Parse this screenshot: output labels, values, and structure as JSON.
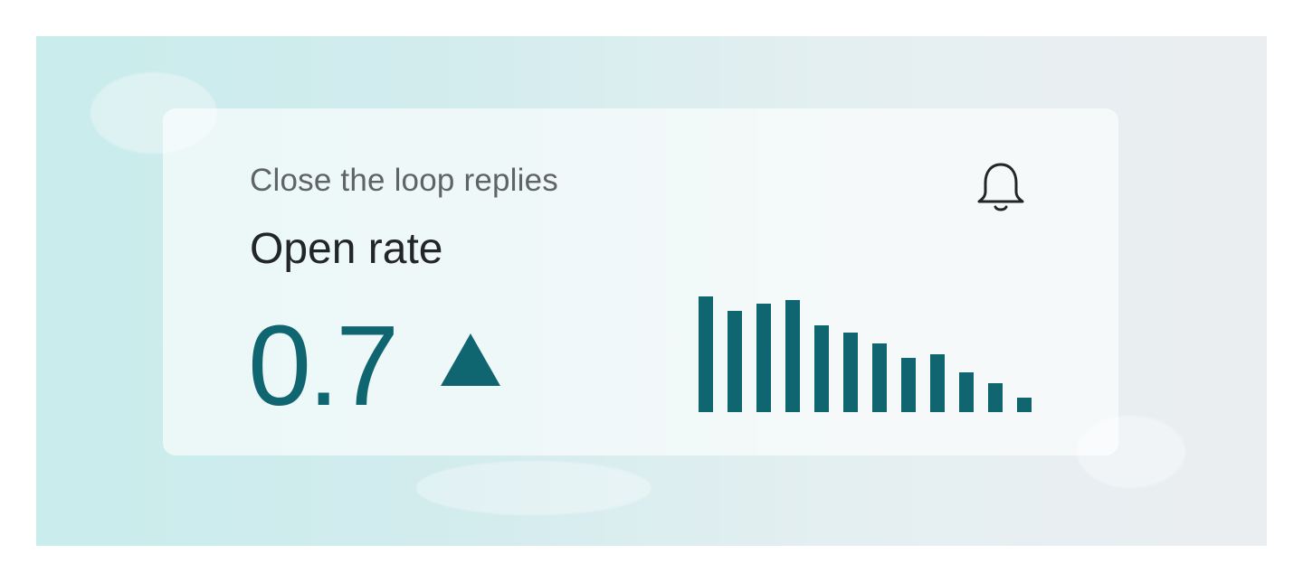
{
  "card": {
    "subtitle": "Close the loop replies",
    "title": "Open rate",
    "metric_value": "0.7",
    "trend_direction": "up",
    "trend_icon": "triangle-up-icon",
    "notification_icon": "bell-icon"
  },
  "colors": {
    "accent": "#0f6670",
    "title_text": "#232628",
    "subtitle_text": "#5f6467",
    "card_background": "#f1f5f6"
  },
  "chart_data": {
    "type": "bar",
    "values": [
      128,
      112,
      120,
      124,
      96,
      88,
      76,
      60,
      64,
      44,
      32,
      16
    ]
  }
}
